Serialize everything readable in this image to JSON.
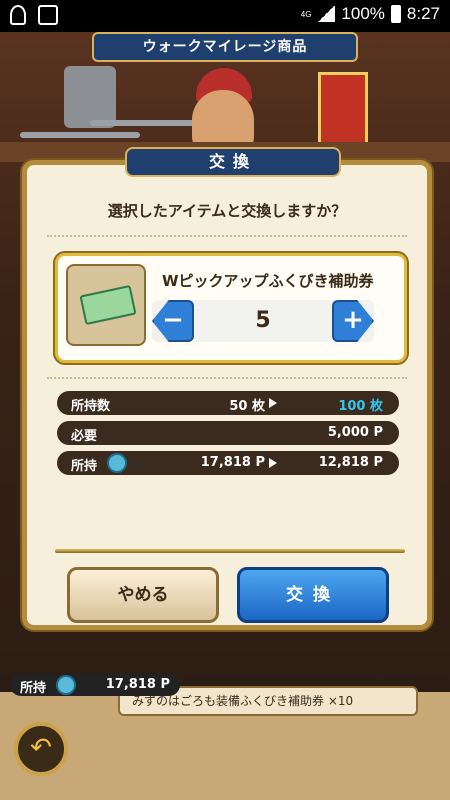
{
  "status_bar": {
    "network": "4G",
    "battery": "100%",
    "time": "8:27"
  },
  "screen": {
    "title": "ウォークマイレージ商品"
  },
  "dialog": {
    "header": "交換",
    "question": "選択したアイテムと交換しますか？",
    "item": {
      "name": "Wピックアップふくびき補助券",
      "quantity": "5",
      "minus_label": "−",
      "plus_label": "+"
    },
    "stats": {
      "owned_label": "所持数",
      "owned_before": "50 枚",
      "owned_after": "100 枚",
      "required_label": "必要",
      "required_value": "5,000 P",
      "balance_label": "所持",
      "balance_before": "17,818 P",
      "balance_after": "12,818 P"
    },
    "buttons": {
      "cancel": "やめる",
      "exchange": "交換"
    }
  },
  "background": {
    "holding_label": "所持",
    "holding_value": "17,818 P",
    "list_item_text": "みずのはごろも装備ふくびき補助券 ×10"
  },
  "colors": {
    "dialog_bg": "#f6efdc",
    "header_blue": "#1f3f6e",
    "gold": "#d9b25a",
    "exchange_blue": "#1a67c4",
    "highlight_cyan": "#32c7f0"
  }
}
